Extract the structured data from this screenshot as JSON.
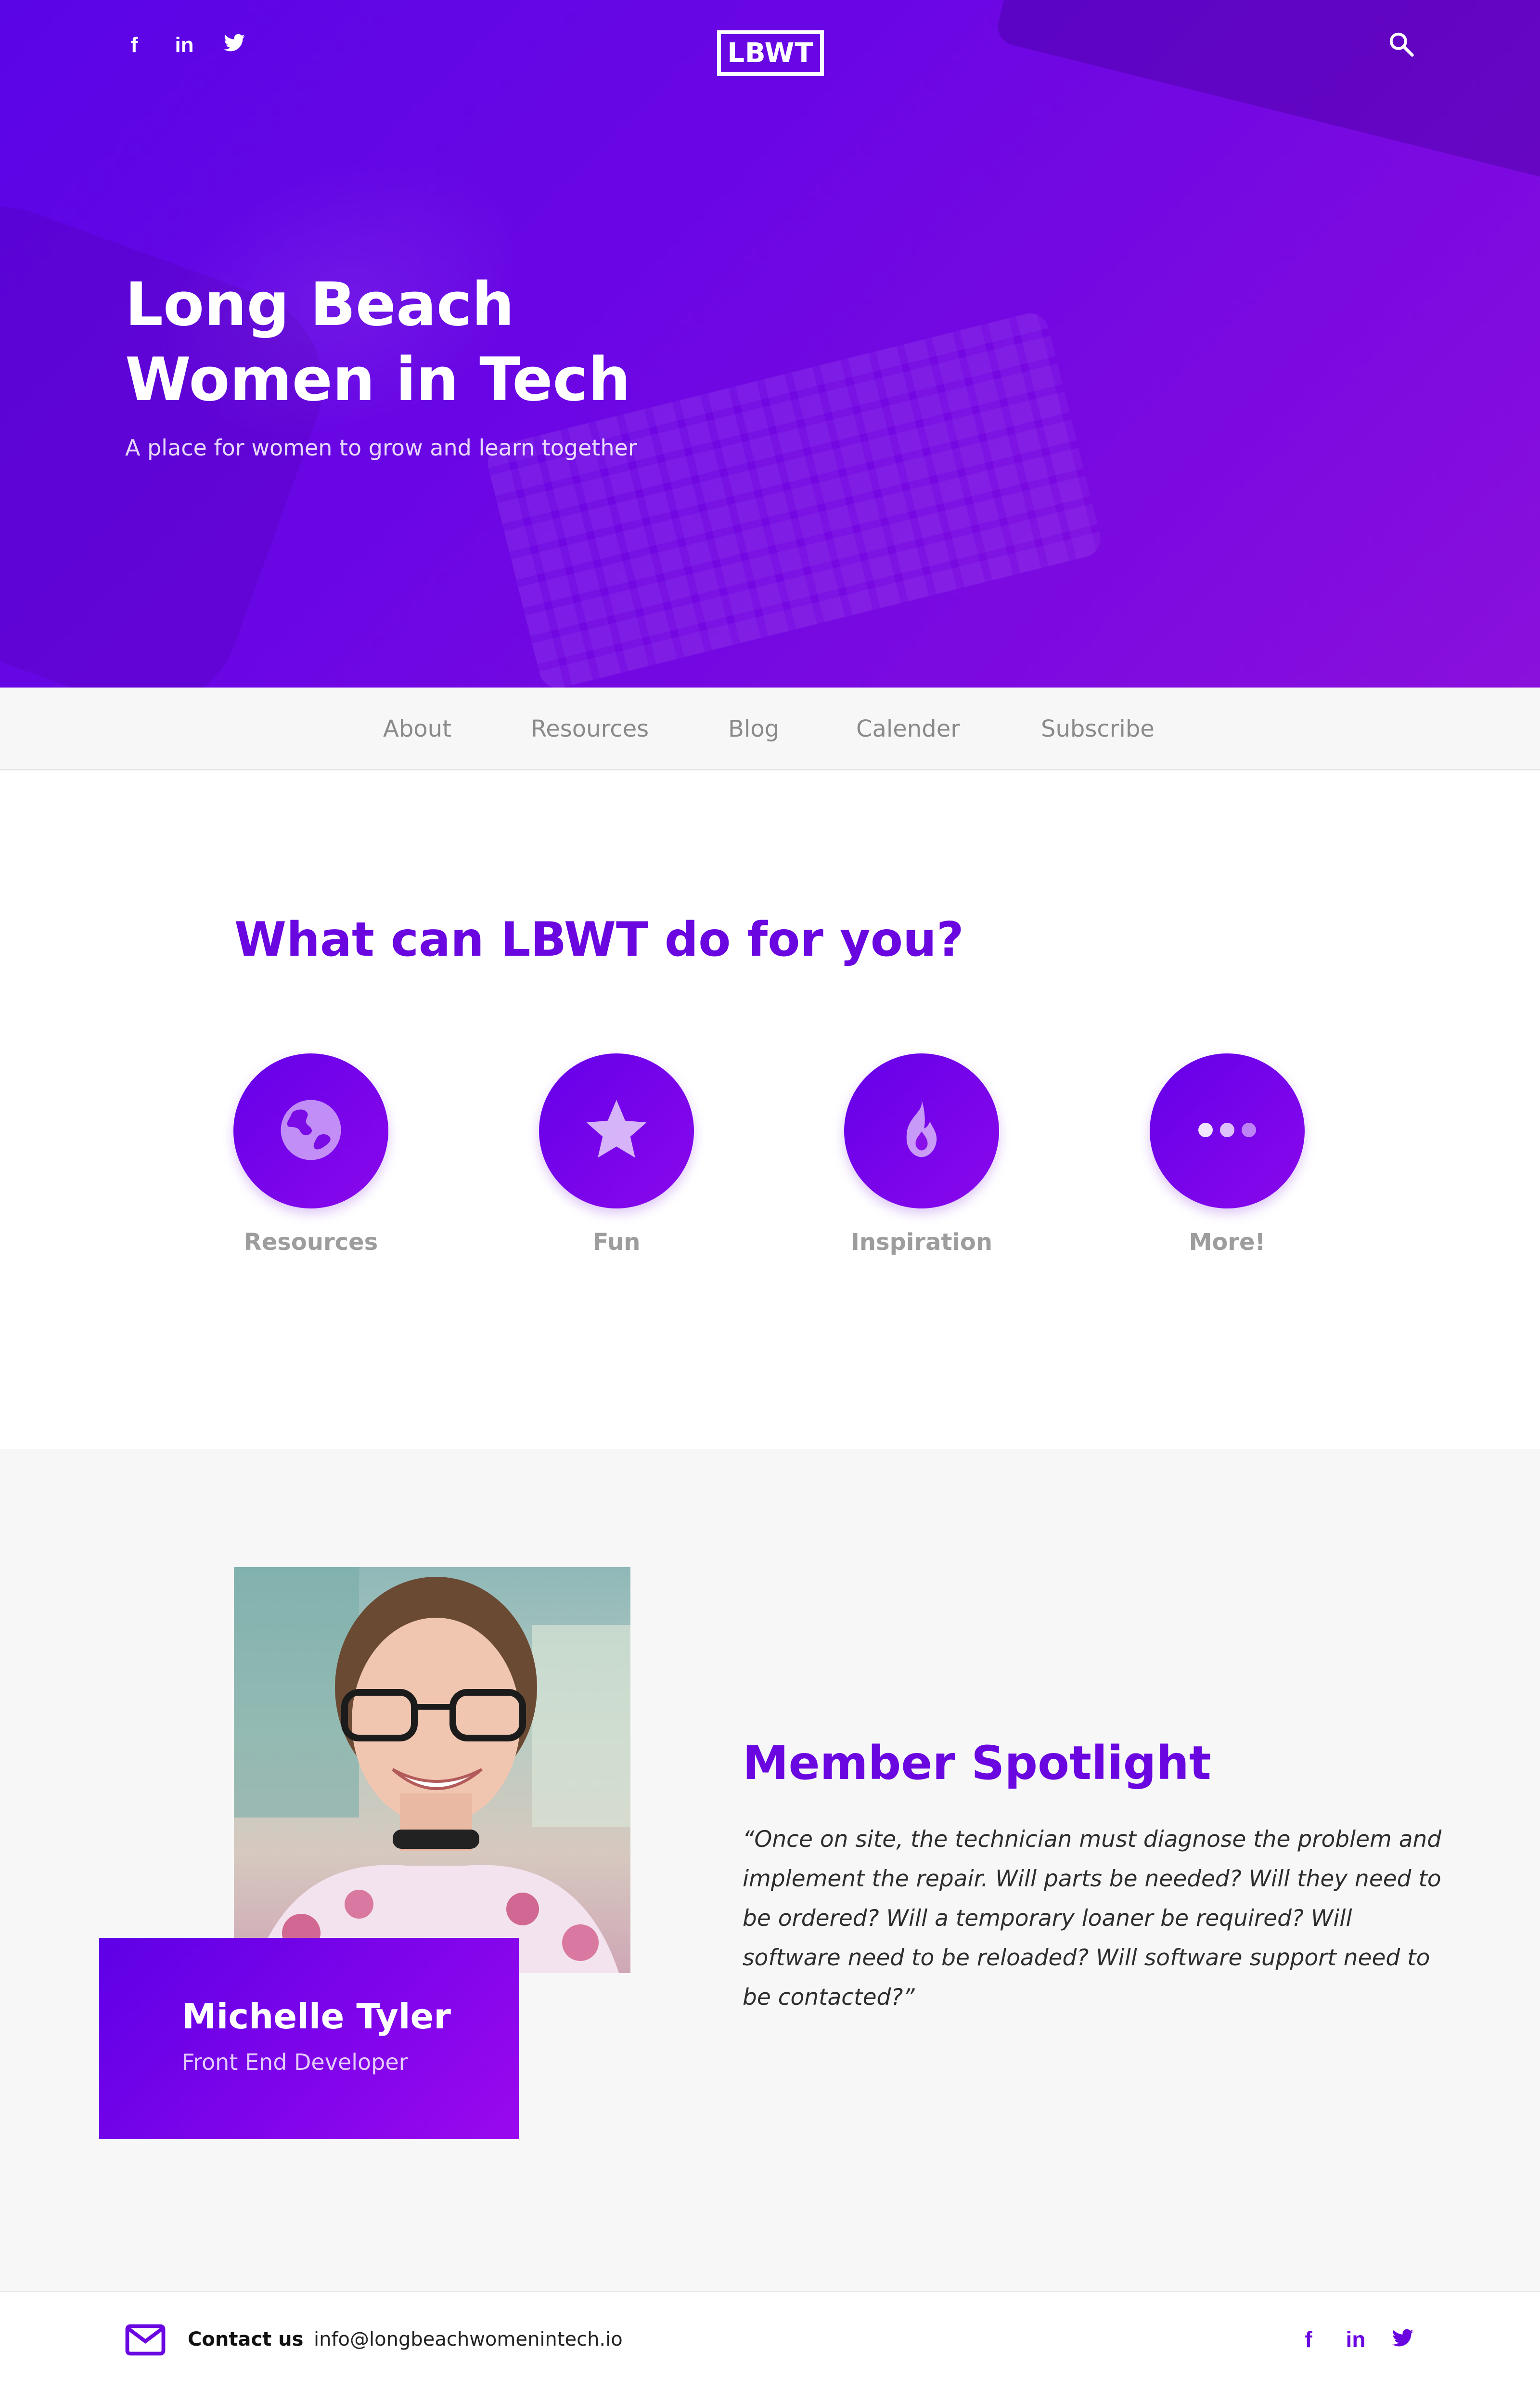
{
  "header": {
    "social_icons": [
      "facebook-icon",
      "linkedin-icon",
      "twitter-icon"
    ],
    "logo_text": "LBWT",
    "search_icon": "search-icon"
  },
  "hero": {
    "title": "Long Beach\nWomen in Tech",
    "tagline": "A place for women to grow and learn together"
  },
  "nav": {
    "items": [
      {
        "label": "About"
      },
      {
        "label": "Resources"
      },
      {
        "label": "Blog"
      },
      {
        "label": "Calender"
      },
      {
        "label": "Subscribe"
      }
    ]
  },
  "services": {
    "title": "What can LBWT do for you?",
    "items": [
      {
        "label": "Resources",
        "icon": "globe-icon"
      },
      {
        "label": "Fun",
        "icon": "star-icon"
      },
      {
        "label": "Inspiration",
        "icon": "flame-icon"
      },
      {
        "label": "More!",
        "icon": "more-dots-icon"
      }
    ]
  },
  "spotlight": {
    "title": "Member Spotlight",
    "name": "Michelle Tyler",
    "role": "Front End Developer",
    "quote": "“Once on site, the technician must diagnose the problem and implement the repair. Will parts be needed? Will they need to be ordered? Will a temporary loaner be required? Will software need to be reloaded? Will software support need to be contacted?”"
  },
  "footer": {
    "contact_label": "Contact us",
    "email": "info@longbeachwomenintech.io",
    "social_icons": [
      "facebook-icon",
      "linkedin-icon",
      "twitter-icon"
    ]
  },
  "colors": {
    "brand_purple": "#6a06e0",
    "hero_gradient_start": "#5a05e6",
    "hero_gradient_end": "#8a10dc",
    "nav_background": "#f7f7f7",
    "spotlight_background": "#f7f7f7",
    "muted_text": "#9d9d9d"
  }
}
